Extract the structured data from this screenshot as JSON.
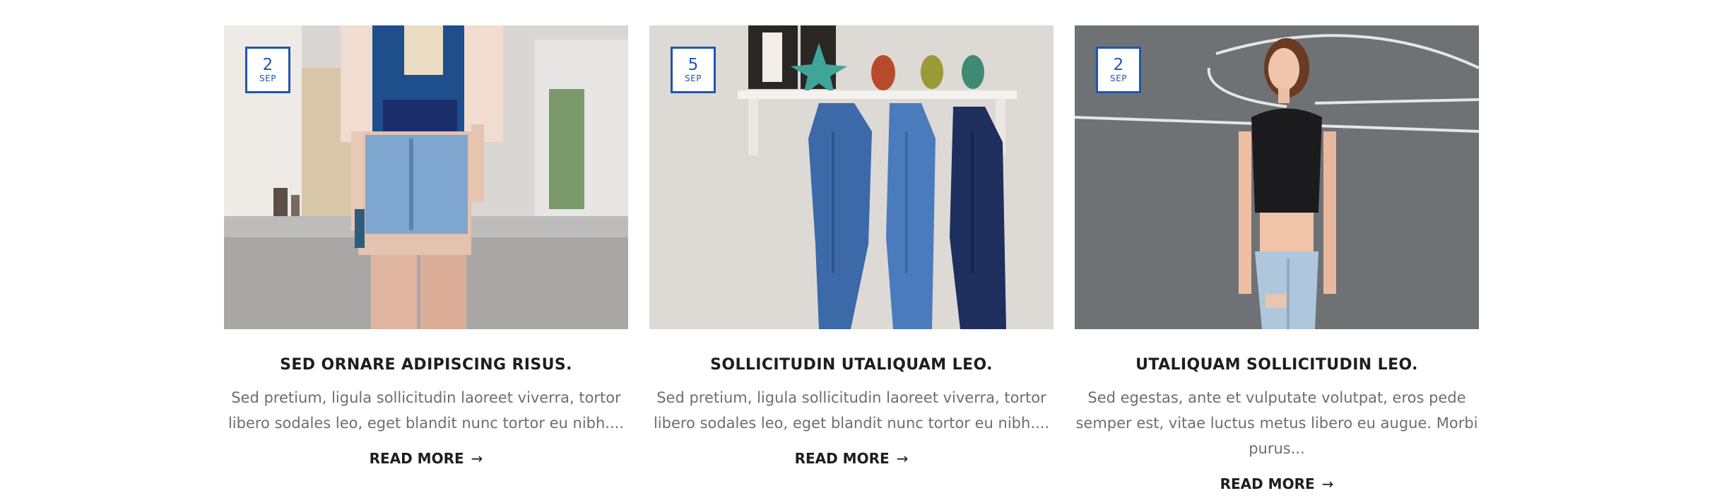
{
  "posts": [
    {
      "day": "2",
      "month": "SEP",
      "title": "SED ORNARE ADIPISCING RISUS.",
      "excerpt": "Sed pretium, ligula sollicitudin laoreet viverra, tortor libero sodales leo, eget blandit nunc tortor eu nibh....",
      "read_more": "READ MORE",
      "arrow": "→",
      "image": "woman-in-denim-shorts-on-street-photo"
    },
    {
      "day": "5",
      "month": "SEP",
      "title": "SOLLICITUDIN UTALIQUAM LEO.",
      "excerpt": "Sed pretium, ligula sollicitudin laoreet viverra, tortor libero sodales leo, eget blandit nunc tortor eu nibh....",
      "read_more": "READ MORE",
      "arrow": "→",
      "image": "denim-jackets-on-wall-shelf-photo"
    },
    {
      "day": "2",
      "month": "SEP",
      "title": "UTALIQUAM SOLLICITUDIN LEO.",
      "excerpt": "Sed egestas, ante et vulputate volutpat, eros pede semper est, vitae luctus metus libero eu augue. Morbi purus...",
      "read_more": "READ MORE",
      "arrow": "→",
      "image": "woman-in-black-top-on-court-photo"
    }
  ],
  "colors": {
    "accent": "#1f57ad",
    "title": "#1d1d1d",
    "excerpt": "#6e6e6e"
  }
}
